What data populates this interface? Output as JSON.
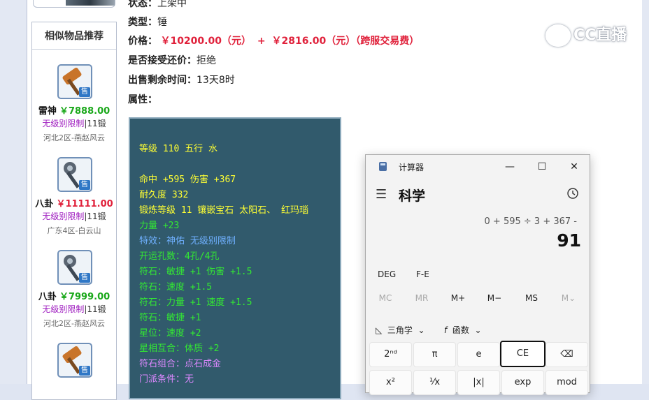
{
  "sidebar": {
    "title": "相似物品推荐",
    "items": [
      {
        "name": "雷神",
        "price": "￥7888.00",
        "price_color": "green",
        "restriction": "无级别限制",
        "level": "|11锻",
        "server": "河北2区-燕赵风云",
        "tag": "售",
        "icon": "hammer-icon"
      },
      {
        "name": "八卦",
        "price": "￥11111.00",
        "price_color": "red",
        "restriction": "无级别限制",
        "level": "|11锻",
        "server": "广东4区-白云山",
        "tag": "售",
        "icon": "hammer-icon"
      },
      {
        "name": "八卦",
        "price": "￥7999.00",
        "price_color": "green",
        "restriction": "无级别限制",
        "level": "|11锻",
        "server": "河北2区-燕赵风云",
        "tag": "售",
        "icon": "hammer-icon"
      },
      {
        "tag": "售",
        "icon": "hammer-icon"
      }
    ]
  },
  "detail": {
    "status_label": "状态：",
    "status_value": "上架中",
    "type_label": "类型：",
    "type_value": "锤",
    "price_label": "价格：",
    "price_value": "￥10200.00（元）",
    "price_plus": "+",
    "fee_value": "￥2816.00（元）（跨服交易费）",
    "counter_label": "是否接受还价：",
    "counter_value": "拒绝",
    "time_label": "出售剩余时间：",
    "time_value": "13天8时",
    "attr_label": "属性："
  },
  "attributes": [
    {
      "text": "等级 110 五行 水",
      "color": "yellow"
    },
    {
      "text": "命中 +595 伤害 +367",
      "color": "yellow"
    },
    {
      "text": "耐久度 332",
      "color": "yellow"
    },
    {
      "text": "锻炼等级 11 镶嵌宝石 太阳石、 红玛瑙",
      "color": "yellow"
    },
    {
      "text": "力量 +23",
      "color": "green"
    },
    {
      "text": "特效：神佑 无级别限制",
      "color": "blue"
    },
    {
      "text": "开运孔数：4孔/4孔",
      "color": "green"
    },
    {
      "text": "符石：敏捷 +1 伤害 +1.5",
      "color": "green"
    },
    {
      "text": "符石：速度 +1.5",
      "color": "green"
    },
    {
      "text": "符石：力量 +1 速度 +1.5",
      "color": "green"
    },
    {
      "text": "符石：敏捷 +1",
      "color": "green"
    },
    {
      "text": "星位：速度 +2",
      "color": "green"
    },
    {
      "text": "星相互合：体质 +2",
      "color": "green"
    },
    {
      "text": "符石组合：点石成金",
      "color": "purple"
    },
    {
      "text": "门派条件：无",
      "color": "purple"
    }
  ],
  "watermark": {
    "text": "CC直播"
  },
  "calculator": {
    "app_title": "计算器",
    "mode": "科学",
    "expression": "0 + 595 ÷ 3 + 367 -",
    "result": "91",
    "angle_mode": "DEG",
    "fe_label": "F-E",
    "memory": [
      {
        "label": "MC",
        "enabled": false
      },
      {
        "label": "MR",
        "enabled": false
      },
      {
        "label": "M+",
        "enabled": true
      },
      {
        "label": "M−",
        "enabled": true
      },
      {
        "label": "MS",
        "enabled": true
      },
      {
        "label": "M⌄",
        "enabled": false
      }
    ],
    "trig_label": "三角学",
    "func_label": "函数",
    "keys_row1": [
      "2ⁿᵈ",
      "π",
      "e",
      "CE",
      "⌫"
    ],
    "keys_row2": [
      "x²",
      "¹⁄x",
      "|x|",
      "exp",
      "mod"
    ],
    "window_controls": {
      "minimize": "—",
      "maximize": "☐",
      "close": "✕"
    }
  }
}
